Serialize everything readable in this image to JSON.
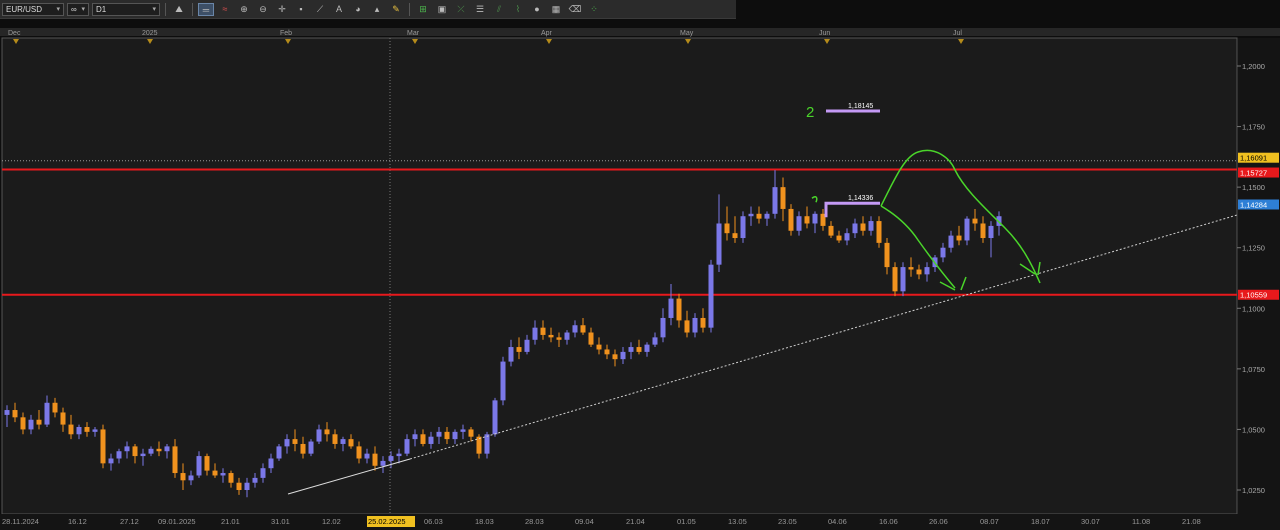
{
  "toolbar": {
    "symbol": "EUR/USD",
    "timeframe": "D1",
    "buttons": [
      "crosshair-icon",
      "compare-icon",
      "chart-type-icon",
      "indicator-icon",
      "drawing-icon",
      "zoom-in-icon",
      "zoom-out-icon",
      "cursor-icon",
      "point-icon",
      "line-icon",
      "shape-icon",
      "text-icon",
      "brush-icon",
      "settings-icon",
      "grid-icon",
      "pen-icon",
      "tools-icon",
      "objects-icon",
      "eye-icon",
      "eraser-icon",
      "more-icon"
    ]
  },
  "colors": {
    "bull": "#7b78e8",
    "bear": "#f0921e",
    "level_line": "#e8191c",
    "projection": "#4ad52a",
    "target": "#c49af5",
    "label_current": "#2e7fd6",
    "label_upper": "#f0c020"
  },
  "chart_data": {
    "type": "candlestick",
    "symbol": "EUR/USD",
    "timeframe": "D1",
    "ylim": [
      1.02,
      1.205
    ],
    "y_ticks": [
      "1,2000",
      "1,1750",
      "1,1500",
      "1,1250",
      "1,1000",
      "1,0750",
      "1,0500",
      "1,0250"
    ],
    "y_tick_values": [
      1.2,
      1.175,
      1.15,
      1.125,
      1.1,
      1.075,
      1.05,
      1.025
    ],
    "month_markers": [
      "Dec",
      "2025",
      "Feb",
      "Mar",
      "Apr",
      "May",
      "Jun",
      "Jul"
    ],
    "x_date_ticks": [
      "28.11.2024",
      "16.12",
      "27.12",
      "09.01.2025",
      "21.01",
      "31.01",
      "12.02",
      "25.02.2025",
      "06.03",
      "18.03",
      "28.03",
      "09.04",
      "21.04",
      "01.05",
      "13.05",
      "23.05",
      "04.06",
      "16.06",
      "26.06",
      "08.07",
      "18.07",
      "30.07",
      "11.08",
      "21.08"
    ],
    "highlighted_date": "25.02.2025",
    "price_labels": {
      "upper_dotted": "1,16091",
      "upper_level": "1,15727",
      "current": "1,14284",
      "lower_level": "1,10559"
    },
    "horizontal_levels": [
      1.15727,
      1.10559
    ],
    "upper_dotted_level": 1.16091,
    "trendline": {
      "start": [
        "31.01",
        1.022
      ],
      "end": [
        "21.08",
        1.14
      ]
    },
    "annotations": [
      {
        "label": "1,18145",
        "marker": "2",
        "value": 1.18145
      },
      {
        "label": "1,14336",
        "marker": "1",
        "value": 1.14336
      }
    ],
    "candles": [
      {
        "o": 1.056,
        "h": 1.06,
        "l": 1.051,
        "c": 1.058
      },
      {
        "o": 1.058,
        "h": 1.061,
        "l": 1.053,
        "c": 1.055
      },
      {
        "o": 1.055,
        "h": 1.057,
        "l": 1.048,
        "c": 1.05
      },
      {
        "o": 1.05,
        "h": 1.056,
        "l": 1.048,
        "c": 1.054
      },
      {
        "o": 1.054,
        "h": 1.058,
        "l": 1.05,
        "c": 1.052
      },
      {
        "o": 1.052,
        "h": 1.064,
        "l": 1.051,
        "c": 1.061
      },
      {
        "o": 1.061,
        "h": 1.063,
        "l": 1.055,
        "c": 1.057
      },
      {
        "o": 1.057,
        "h": 1.059,
        "l": 1.049,
        "c": 1.052
      },
      {
        "o": 1.052,
        "h": 1.056,
        "l": 1.046,
        "c": 1.048
      },
      {
        "o": 1.048,
        "h": 1.052,
        "l": 1.046,
        "c": 1.051
      },
      {
        "o": 1.051,
        "h": 1.053,
        "l": 1.047,
        "c": 1.049
      },
      {
        "o": 1.049,
        "h": 1.051,
        "l": 1.047,
        "c": 1.05
      },
      {
        "o": 1.05,
        "h": 1.052,
        "l": 1.034,
        "c": 1.036
      },
      {
        "o": 1.036,
        "h": 1.04,
        "l": 1.033,
        "c": 1.038
      },
      {
        "o": 1.038,
        "h": 1.042,
        "l": 1.036,
        "c": 1.041
      },
      {
        "o": 1.041,
        "h": 1.045,
        "l": 1.038,
        "c": 1.043
      },
      {
        "o": 1.043,
        "h": 1.044,
        "l": 1.036,
        "c": 1.039
      },
      {
        "o": 1.039,
        "h": 1.042,
        "l": 1.035,
        "c": 1.04
      },
      {
        "o": 1.04,
        "h": 1.043,
        "l": 1.039,
        "c": 1.042
      },
      {
        "o": 1.042,
        "h": 1.045,
        "l": 1.039,
        "c": 1.041
      },
      {
        "o": 1.041,
        "h": 1.044,
        "l": 1.038,
        "c": 1.043
      },
      {
        "o": 1.043,
        "h": 1.046,
        "l": 1.03,
        "c": 1.032
      },
      {
        "o": 1.032,
        "h": 1.036,
        "l": 1.025,
        "c": 1.029
      },
      {
        "o": 1.029,
        "h": 1.033,
        "l": 1.027,
        "c": 1.031
      },
      {
        "o": 1.031,
        "h": 1.041,
        "l": 1.03,
        "c": 1.039
      },
      {
        "o": 1.039,
        "h": 1.04,
        "l": 1.031,
        "c": 1.033
      },
      {
        "o": 1.033,
        "h": 1.036,
        "l": 1.03,
        "c": 1.031
      },
      {
        "o": 1.031,
        "h": 1.034,
        "l": 1.028,
        "c": 1.032
      },
      {
        "o": 1.032,
        "h": 1.033,
        "l": 1.026,
        "c": 1.028
      },
      {
        "o": 1.028,
        "h": 1.03,
        "l": 1.023,
        "c": 1.025
      },
      {
        "o": 1.025,
        "h": 1.03,
        "l": 1.022,
        "c": 1.028
      },
      {
        "o": 1.028,
        "h": 1.032,
        "l": 1.026,
        "c": 1.03
      },
      {
        "o": 1.03,
        "h": 1.036,
        "l": 1.028,
        "c": 1.034
      },
      {
        "o": 1.034,
        "h": 1.04,
        "l": 1.032,
        "c": 1.038
      },
      {
        "o": 1.038,
        "h": 1.044,
        "l": 1.037,
        "c": 1.043
      },
      {
        "o": 1.043,
        "h": 1.048,
        "l": 1.04,
        "c": 1.046
      },
      {
        "o": 1.046,
        "h": 1.05,
        "l": 1.041,
        "c": 1.044
      },
      {
        "o": 1.044,
        "h": 1.047,
        "l": 1.038,
        "c": 1.04
      },
      {
        "o": 1.04,
        "h": 1.046,
        "l": 1.039,
        "c": 1.045
      },
      {
        "o": 1.045,
        "h": 1.052,
        "l": 1.044,
        "c": 1.05
      },
      {
        "o": 1.05,
        "h": 1.053,
        "l": 1.045,
        "c": 1.048
      },
      {
        "o": 1.048,
        "h": 1.05,
        "l": 1.042,
        "c": 1.044
      },
      {
        "o": 1.044,
        "h": 1.047,
        "l": 1.041,
        "c": 1.046
      },
      {
        "o": 1.046,
        "h": 1.048,
        "l": 1.042,
        "c": 1.043
      },
      {
        "o": 1.043,
        "h": 1.045,
        "l": 1.036,
        "c": 1.038
      },
      {
        "o": 1.038,
        "h": 1.042,
        "l": 1.036,
        "c": 1.04
      },
      {
        "o": 1.04,
        "h": 1.043,
        "l": 1.033,
        "c": 1.035
      },
      {
        "o": 1.035,
        "h": 1.039,
        "l": 1.032,
        "c": 1.037
      },
      {
        "o": 1.037,
        "h": 1.041,
        "l": 1.034,
        "c": 1.039
      },
      {
        "o": 1.039,
        "h": 1.042,
        "l": 1.036,
        "c": 1.04
      },
      {
        "o": 1.04,
        "h": 1.048,
        "l": 1.039,
        "c": 1.046
      },
      {
        "o": 1.046,
        "h": 1.05,
        "l": 1.043,
        "c": 1.048
      },
      {
        "o": 1.048,
        "h": 1.05,
        "l": 1.043,
        "c": 1.044
      },
      {
        "o": 1.044,
        "h": 1.049,
        "l": 1.042,
        "c": 1.047
      },
      {
        "o": 1.047,
        "h": 1.051,
        "l": 1.044,
        "c": 1.049
      },
      {
        "o": 1.049,
        "h": 1.051,
        "l": 1.044,
        "c": 1.046
      },
      {
        "o": 1.046,
        "h": 1.05,
        "l": 1.044,
        "c": 1.049
      },
      {
        "o": 1.049,
        "h": 1.052,
        "l": 1.046,
        "c": 1.05
      },
      {
        "o": 1.05,
        "h": 1.051,
        "l": 1.045,
        "c": 1.047
      },
      {
        "o": 1.047,
        "h": 1.048,
        "l": 1.038,
        "c": 1.04
      },
      {
        "o": 1.04,
        "h": 1.049,
        "l": 1.038,
        "c": 1.048
      },
      {
        "o": 1.048,
        "h": 1.063,
        "l": 1.047,
        "c": 1.062
      },
      {
        "o": 1.062,
        "h": 1.08,
        "l": 1.06,
        "c": 1.078
      },
      {
        "o": 1.078,
        "h": 1.087,
        "l": 1.076,
        "c": 1.084
      },
      {
        "o": 1.084,
        "h": 1.088,
        "l": 1.079,
        "c": 1.082
      },
      {
        "o": 1.082,
        "h": 1.089,
        "l": 1.081,
        "c": 1.087
      },
      {
        "o": 1.087,
        "h": 1.095,
        "l": 1.085,
        "c": 1.092
      },
      {
        "o": 1.092,
        "h": 1.095,
        "l": 1.087,
        "c": 1.089
      },
      {
        "o": 1.089,
        "h": 1.092,
        "l": 1.086,
        "c": 1.088
      },
      {
        "o": 1.088,
        "h": 1.09,
        "l": 1.084,
        "c": 1.087
      },
      {
        "o": 1.087,
        "h": 1.091,
        "l": 1.085,
        "c": 1.09
      },
      {
        "o": 1.09,
        "h": 1.095,
        "l": 1.088,
        "c": 1.093
      },
      {
        "o": 1.093,
        "h": 1.096,
        "l": 1.089,
        "c": 1.09
      },
      {
        "o": 1.09,
        "h": 1.092,
        "l": 1.084,
        "c": 1.085
      },
      {
        "o": 1.085,
        "h": 1.088,
        "l": 1.081,
        "c": 1.083
      },
      {
        "o": 1.083,
        "h": 1.085,
        "l": 1.079,
        "c": 1.081
      },
      {
        "o": 1.081,
        "h": 1.083,
        "l": 1.076,
        "c": 1.079
      },
      {
        "o": 1.079,
        "h": 1.084,
        "l": 1.077,
        "c": 1.082
      },
      {
        "o": 1.082,
        "h": 1.086,
        "l": 1.079,
        "c": 1.084
      },
      {
        "o": 1.084,
        "h": 1.087,
        "l": 1.081,
        "c": 1.082
      },
      {
        "o": 1.082,
        "h": 1.086,
        "l": 1.08,
        "c": 1.085
      },
      {
        "o": 1.085,
        "h": 1.09,
        "l": 1.084,
        "c": 1.088
      },
      {
        "o": 1.088,
        "h": 1.1,
        "l": 1.086,
        "c": 1.096
      },
      {
        "o": 1.096,
        "h": 1.11,
        "l": 1.093,
        "c": 1.104
      },
      {
        "o": 1.104,
        "h": 1.106,
        "l": 1.092,
        "c": 1.095
      },
      {
        "o": 1.095,
        "h": 1.099,
        "l": 1.088,
        "c": 1.09
      },
      {
        "o": 1.09,
        "h": 1.098,
        "l": 1.088,
        "c": 1.096
      },
      {
        "o": 1.096,
        "h": 1.1,
        "l": 1.09,
        "c": 1.092
      },
      {
        "o": 1.092,
        "h": 1.12,
        "l": 1.09,
        "c": 1.118
      },
      {
        "o": 1.118,
        "h": 1.147,
        "l": 1.115,
        "c": 1.135
      },
      {
        "o": 1.135,
        "h": 1.142,
        "l": 1.128,
        "c": 1.131
      },
      {
        "o": 1.131,
        "h": 1.138,
        "l": 1.127,
        "c": 1.129
      },
      {
        "o": 1.129,
        "h": 1.14,
        "l": 1.127,
        "c": 1.138
      },
      {
        "o": 1.138,
        "h": 1.142,
        "l": 1.134,
        "c": 1.139
      },
      {
        "o": 1.139,
        "h": 1.142,
        "l": 1.135,
        "c": 1.137
      },
      {
        "o": 1.137,
        "h": 1.14,
        "l": 1.134,
        "c": 1.139
      },
      {
        "o": 1.139,
        "h": 1.157,
        "l": 1.137,
        "c": 1.15
      },
      {
        "o": 1.15,
        "h": 1.154,
        "l": 1.136,
        "c": 1.141
      },
      {
        "o": 1.141,
        "h": 1.143,
        "l": 1.13,
        "c": 1.132
      },
      {
        "o": 1.132,
        "h": 1.14,
        "l": 1.13,
        "c": 1.138
      },
      {
        "o": 1.138,
        "h": 1.142,
        "l": 1.133,
        "c": 1.135
      },
      {
        "o": 1.135,
        "h": 1.14,
        "l": 1.131,
        "c": 1.139
      },
      {
        "o": 1.139,
        "h": 1.141,
        "l": 1.132,
        "c": 1.134
      },
      {
        "o": 1.134,
        "h": 1.136,
        "l": 1.129,
        "c": 1.13
      },
      {
        "o": 1.13,
        "h": 1.132,
        "l": 1.127,
        "c": 1.128
      },
      {
        "o": 1.128,
        "h": 1.133,
        "l": 1.126,
        "c": 1.131
      },
      {
        "o": 1.131,
        "h": 1.137,
        "l": 1.129,
        "c": 1.135
      },
      {
        "o": 1.135,
        "h": 1.138,
        "l": 1.13,
        "c": 1.132
      },
      {
        "o": 1.132,
        "h": 1.138,
        "l": 1.13,
        "c": 1.136
      },
      {
        "o": 1.136,
        "h": 1.138,
        "l": 1.125,
        "c": 1.127
      },
      {
        "o": 1.127,
        "h": 1.129,
        "l": 1.114,
        "c": 1.117
      },
      {
        "o": 1.117,
        "h": 1.119,
        "l": 1.105,
        "c": 1.107
      },
      {
        "o": 1.107,
        "h": 1.119,
        "l": 1.105,
        "c": 1.117
      },
      {
        "o": 1.117,
        "h": 1.121,
        "l": 1.113,
        "c": 1.116
      },
      {
        "o": 1.116,
        "h": 1.118,
        "l": 1.112,
        "c": 1.114
      },
      {
        "o": 1.114,
        "h": 1.119,
        "l": 1.111,
        "c": 1.117
      },
      {
        "o": 1.117,
        "h": 1.122,
        "l": 1.115,
        "c": 1.121
      },
      {
        "o": 1.121,
        "h": 1.127,
        "l": 1.119,
        "c": 1.125
      },
      {
        "o": 1.125,
        "h": 1.132,
        "l": 1.123,
        "c": 1.13
      },
      {
        "o": 1.13,
        "h": 1.134,
        "l": 1.126,
        "c": 1.128
      },
      {
        "o": 1.128,
        "h": 1.138,
        "l": 1.126,
        "c": 1.137
      },
      {
        "o": 1.137,
        "h": 1.141,
        "l": 1.132,
        "c": 1.135
      },
      {
        "o": 1.135,
        "h": 1.138,
        "l": 1.127,
        "c": 1.129
      },
      {
        "o": 1.129,
        "h": 1.136,
        "l": 1.121,
        "c": 1.134
      },
      {
        "o": 1.134,
        "h": 1.14,
        "l": 1.13,
        "c": 1.138
      }
    ]
  }
}
